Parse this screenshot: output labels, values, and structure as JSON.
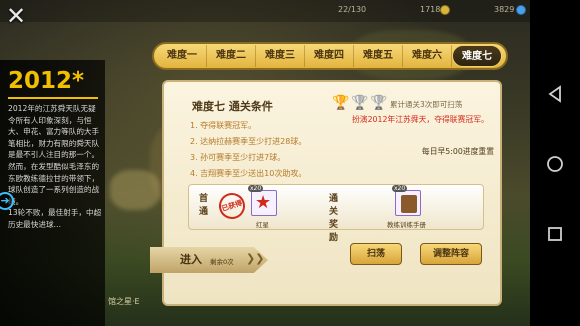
{
  "top": {
    "energy": "22/130",
    "coins": "1718",
    "gems": "3829"
  },
  "story": {
    "year": "2012*",
    "paragraphs": [
      "2012年的江苏舜天队无疑令所有人印象深刻，与恒大、申花、富力等队的大手笔相比，财力有限的舜天队是最不引人注目的那一个。然而，在发型酷似毛泽东的东欧教练德拉甘的带领下，球队创造了一系列创造的战绩。",
      "13轮不败，最佳射手，中超历史最快进球…"
    ]
  },
  "tabs": [
    "难度一",
    "难度二",
    "难度三",
    "难度四",
    "难度五",
    "难度六",
    "难度七"
  ],
  "active_tab_index": 6,
  "panel": {
    "title": "难度七 通关条件",
    "conditions": [
      "1. 夺得联赛冠军。",
      "2. 达纳拉赫赛季至少打进28球。",
      "3. 孙可赛季至少打进7球。",
      "4. 吉翔赛季至少送出10次助攻。"
    ],
    "trophy_note": "累计通关3次即可扫荡",
    "special_condition": "扮演2012年江苏舜天，夺得联赛冠军。",
    "reset_note": "每日早5:00进度重置",
    "first_clear_label": "首通",
    "first_clear_stamp": "已获得",
    "reward_1": {
      "count": "x20",
      "name": "红星"
    },
    "clear_reward_label": "通关奖励",
    "reward_2": {
      "count": "x20",
      "name": "教练训练手册"
    }
  },
  "buttons": {
    "enter": "进入",
    "enter_remaining": "剩余0次",
    "sweep": "扫荡",
    "adjust_lineup": "调整阵容"
  },
  "bottom_info": "馆之星·E"
}
